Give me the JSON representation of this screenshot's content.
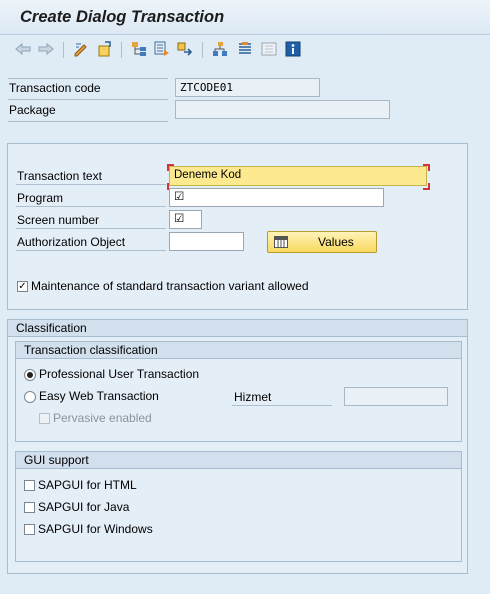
{
  "window": {
    "title": "Create Dialog Transaction"
  },
  "toolbar": {
    "icons": [
      "back-arrow-icon",
      "forward-arrow-icon",
      "edit-pen-icon",
      "other-object-icon",
      "hierarchy-icon",
      "save-local-icon",
      "transport-icon",
      "object-list-icon",
      "display-list-icon",
      "layout-icon",
      "info-icon"
    ]
  },
  "header": {
    "transaction_code_label": "Transaction code",
    "transaction_code_value": "ZTCODE01",
    "package_label": "Package",
    "package_value": ""
  },
  "main": {
    "transaction_text_label": "Transaction text",
    "transaction_text_value": "Deneme Kod",
    "program_label": "Program",
    "program_value": "☑",
    "screen_number_label": "Screen number",
    "screen_number_value": "☑",
    "auth_object_label": "Authorization Object",
    "auth_object_value": "",
    "values_button_label": "Values",
    "maintenance_checkbox_label": "Maintenance of standard transaction variant allowed",
    "maintenance_checked": "✓"
  },
  "classification": {
    "title": "Classification",
    "transaction_classification": {
      "title": "Transaction classification",
      "professional_label": "Professional User Transaction",
      "easy_web_label": "Easy Web Transaction",
      "hizmet_label": "Hizmet",
      "hizmet_value": "",
      "pervasive_label": "Pervasive enabled"
    },
    "gui_support": {
      "title": "GUI support",
      "html_label": "SAPGUI for HTML",
      "java_label": "SAPGUI for Java",
      "windows_label": "SAPGUI for Windows"
    }
  },
  "colors": {
    "background": "#dfebf5",
    "focus_field": "#fde98f",
    "button": "#f8d95e"
  }
}
